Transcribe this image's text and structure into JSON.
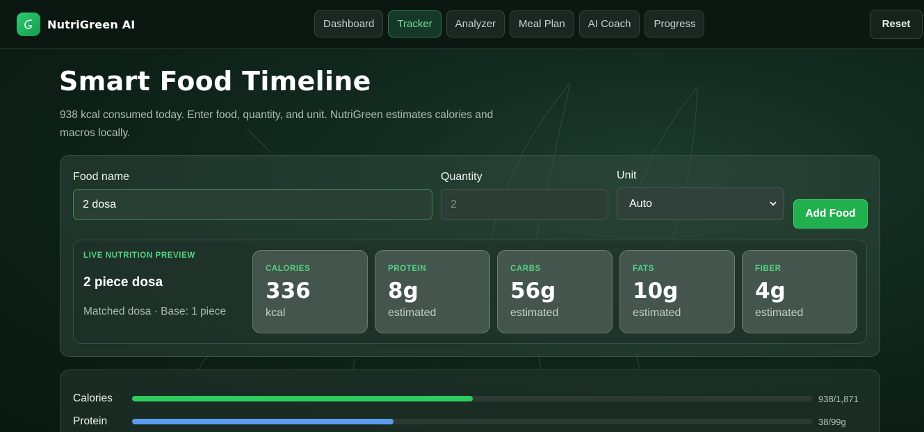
{
  "brand": {
    "name": "NutriGreen AI",
    "icon": "leaf-g-icon"
  },
  "nav": {
    "tabs": [
      {
        "label": "Dashboard",
        "active": false
      },
      {
        "label": "Tracker",
        "active": true
      },
      {
        "label": "Analyzer",
        "active": false
      },
      {
        "label": "Meal Plan",
        "active": false
      },
      {
        "label": "AI Coach",
        "active": false
      },
      {
        "label": "Progress",
        "active": false
      }
    ],
    "reset_label": "Reset"
  },
  "page": {
    "title": "Smart Food Timeline",
    "description": "938 kcal consumed today. Enter food, quantity, and unit. NutriGreen estimates calories and macros locally."
  },
  "form": {
    "food_label": "Food name",
    "food_value": "2 dosa",
    "quantity_label": "Quantity",
    "quantity_placeholder": "2",
    "unit_label": "Unit",
    "unit_value": "Auto",
    "add_label": "Add Food"
  },
  "preview": {
    "kicker": "LIVE NUTRITION PREVIEW",
    "name": "2 piece dosa",
    "match": "Matched dosa · Base: 1 piece",
    "stats": [
      {
        "label": "CALORIES",
        "value": "336",
        "sub": "kcal"
      },
      {
        "label": "PROTEIN",
        "value": "8g",
        "sub": "estimated"
      },
      {
        "label": "CARBS",
        "value": "56g",
        "sub": "estimated"
      },
      {
        "label": "FATS",
        "value": "10g",
        "sub": "estimated"
      },
      {
        "label": "FIBER",
        "value": "4g",
        "sub": "estimated"
      }
    ]
  },
  "progress": [
    {
      "label": "Calories",
      "value": "938/1,871",
      "fraction": 0.501,
      "color": "#2ecc5e"
    },
    {
      "label": "Protein",
      "value": "38/99g",
      "fraction": 0.384,
      "color": "#5b9cf0"
    }
  ],
  "colors": {
    "accent": "#22b04f",
    "accent_text": "#52d483",
    "protein_bar": "#5b9cf0"
  }
}
